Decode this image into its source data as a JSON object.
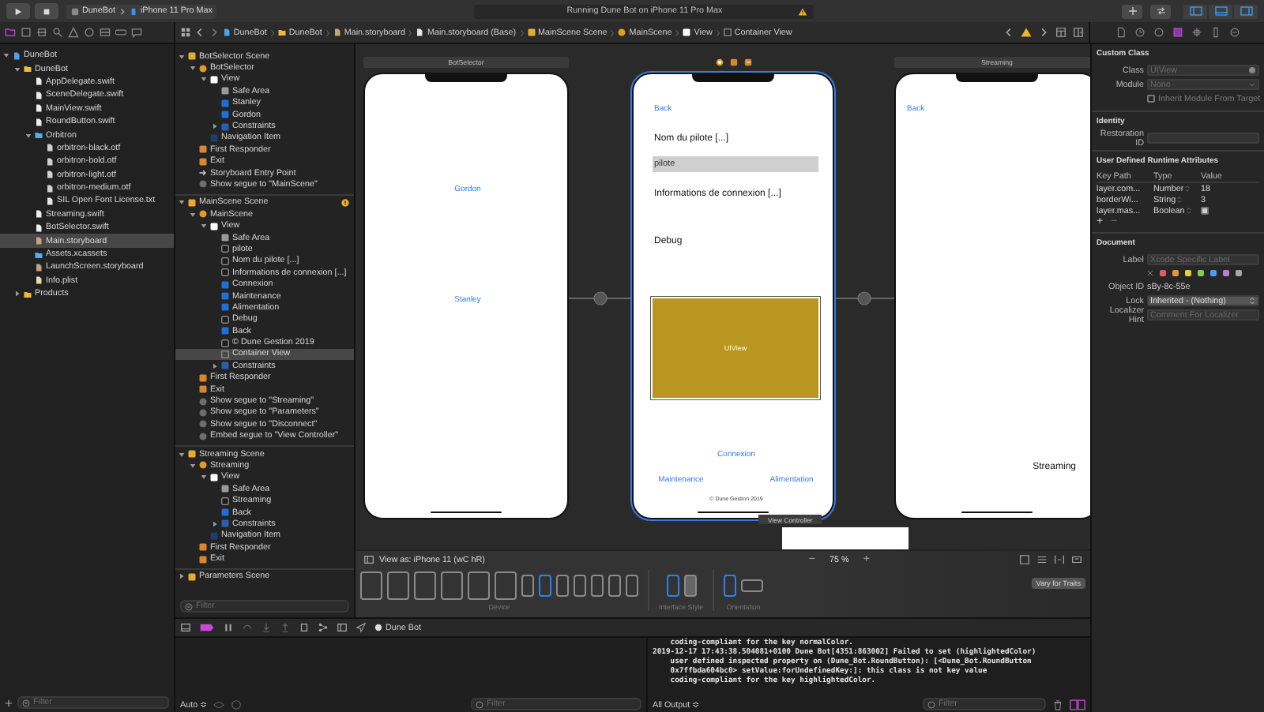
{
  "toolbar": {
    "scheme": "DuneBot",
    "device": "iPhone 11 Pro Max",
    "activity": "Running Dune Bot on iPhone 11 Pro Max",
    "panel_toggles": [
      {
        "kind": "navigator",
        "on": true
      },
      {
        "kind": "debug",
        "on": true
      },
      {
        "kind": "inspector",
        "on": true
      }
    ]
  },
  "navigator_tabs": [
    {
      "selected": true
    },
    {
      "selected": false
    },
    {
      "selected": false
    },
    {
      "selected": false
    },
    {
      "selected": false
    },
    {
      "selected": false
    },
    {
      "selected": false
    },
    {
      "selected": false
    },
    {
      "selected": false
    }
  ],
  "breadcrumbs": [
    {
      "label": "DuneBot",
      "kind": "project"
    },
    {
      "label": "DuneBot",
      "kind": "folder"
    },
    {
      "label": "Main.storyboard",
      "kind": "storyboard"
    },
    {
      "label": "Main.storyboard (Base)",
      "kind": "text"
    },
    {
      "label": "MainScene Scene",
      "kind": "scene"
    },
    {
      "label": "MainScene",
      "kind": "vc"
    },
    {
      "label": "View",
      "kind": "view"
    },
    {
      "label": "Container View",
      "kind": "container"
    }
  ],
  "inspector_tabs": [
    {
      "selected": false
    },
    {
      "selected": false
    },
    {
      "selected": false
    },
    {
      "selected": true
    },
    {
      "selected": false
    },
    {
      "selected": false
    },
    {
      "selected": false
    }
  ],
  "navigator": {
    "items": [
      {
        "label": "DuneBot",
        "kind": "project",
        "selected": false,
        "expanded": true,
        "children": [
          {
            "label": "DuneBot",
            "kind": "folder",
            "selected": false,
            "expanded": true,
            "children": [
              {
                "label": "AppDelegate.swift",
                "kind": "swift",
                "selected": false
              },
              {
                "label": "SceneDelegate.swift",
                "kind": "swift",
                "selected": false
              },
              {
                "label": "MainView.swift",
                "kind": "swift",
                "selected": false
              },
              {
                "label": "RoundButton.swift",
                "kind": "swift",
                "selected": false
              },
              {
                "label": "Orbitron",
                "kind": "bluefolder",
                "selected": false,
                "expanded": true,
                "children": [
                  {
                    "label": "orbitron-black.otf",
                    "kind": "font",
                    "selected": false
                  },
                  {
                    "label": "orbitron-bold.otf",
                    "kind": "font",
                    "selected": false
                  },
                  {
                    "label": "orbitron-light.otf",
                    "kind": "font",
                    "selected": false
                  },
                  {
                    "label": "orbitron-medium.otf",
                    "kind": "font",
                    "selected": false
                  },
                  {
                    "label": "SIL Open Font License.txt",
                    "kind": "text",
                    "selected": false
                  }
                ]
              },
              {
                "label": "Streaming.swift",
                "kind": "swift",
                "selected": false
              },
              {
                "label": "BotSelector.swift",
                "kind": "swift",
                "selected": false
              },
              {
                "label": "Main.storyboard",
                "kind": "storyboard",
                "selected": true
              },
              {
                "label": "Assets.xcassets",
                "kind": "assets",
                "selected": false
              },
              {
                "label": "LaunchScreen.storyboard",
                "kind": "storyboard",
                "selected": false
              },
              {
                "label": "Info.plist",
                "kind": "plist",
                "selected": false
              }
            ]
          },
          {
            "label": "Products",
            "kind": "folder",
            "selected": false,
            "expanded": false
          }
        ]
      }
    ],
    "filter_placeholder": "Filter"
  },
  "outline": {
    "items": [
      {
        "label": "BotSelector Scene",
        "kind": "scene",
        "selected": false,
        "warning": false,
        "expanded": true,
        "children": [
          {
            "label": "BotSelector",
            "kind": "vc",
            "selected": false,
            "expanded": true,
            "children": [
              {
                "label": "View",
                "kind": "view",
                "selected": false,
                "expanded": true,
                "children": [
                  {
                    "label": "Safe Area",
                    "kind": "safe",
                    "selected": false
                  },
                  {
                    "label": "Stanley",
                    "kind": "button",
                    "selected": false
                  },
                  {
                    "label": "Gordon",
                    "kind": "button",
                    "selected": false
                  },
                  {
                    "label": "Constraints",
                    "kind": "constraints",
                    "selected": false,
                    "expanded": false
                  }
                ]
              },
              {
                "label": "Navigation Item",
                "kind": "navitem",
                "selected": false
              }
            ]
          },
          {
            "label": "First Responder",
            "kind": "responder",
            "selected": false
          },
          {
            "label": "Exit",
            "kind": "exit",
            "selected": false
          },
          {
            "label": "Storyboard Entry Point",
            "kind": "entry",
            "selected": false
          },
          {
            "label": "Show segue to \"MainScene\"",
            "kind": "segue",
            "selected": false
          }
        ]
      },
      {
        "label": "MainScene Scene",
        "kind": "scene",
        "selected": false,
        "warning": true,
        "expanded": true,
        "children": [
          {
            "label": "MainScene",
            "kind": "vc",
            "selected": false,
            "expanded": true,
            "children": [
              {
                "label": "View",
                "kind": "view",
                "selected": false,
                "expanded": true,
                "children": [
                  {
                    "label": "Safe Area",
                    "kind": "safe",
                    "selected": false
                  },
                  {
                    "label": "pilote",
                    "kind": "field",
                    "selected": false
                  },
                  {
                    "label": "Nom du pilote [...]",
                    "kind": "label",
                    "selected": false
                  },
                  {
                    "label": "Informations de connexion [...]",
                    "kind": "label",
                    "selected": false
                  },
                  {
                    "label": "Connexion",
                    "kind": "button",
                    "selected": false
                  },
                  {
                    "label": "Maintenance",
                    "kind": "button",
                    "selected": false
                  },
                  {
                    "label": "Alimentation",
                    "kind": "button",
                    "selected": false
                  },
                  {
                    "label": "Debug",
                    "kind": "label",
                    "selected": false
                  },
                  {
                    "label": "Back",
                    "kind": "button",
                    "selected": false
                  },
                  {
                    "label": "© Dune Gestion 2019",
                    "kind": "label",
                    "selected": false
                  },
                  {
                    "label": "Container View",
                    "kind": "container",
                    "selected": true
                  },
                  {
                    "label": "Constraints",
                    "kind": "constraints",
                    "selected": false,
                    "expanded": false
                  }
                ]
              }
            ]
          },
          {
            "label": "First Responder",
            "kind": "responder",
            "selected": false
          },
          {
            "label": "Exit",
            "kind": "exit",
            "selected": false
          },
          {
            "label": "Show segue to \"Streaming\"",
            "kind": "segue",
            "selected": false
          },
          {
            "label": "Show segue to \"Parameters\"",
            "kind": "segue",
            "selected": false
          },
          {
            "label": "Show segue to \"Disconnect\"",
            "kind": "segue",
            "selected": false
          },
          {
            "label": "Embed segue to \"View Controller\"",
            "kind": "segue",
            "selected": false
          }
        ]
      },
      {
        "label": "Streaming Scene",
        "kind": "scene",
        "selected": false,
        "warning": false,
        "expanded": true,
        "children": [
          {
            "label": "Streaming",
            "kind": "vc",
            "selected": false,
            "expanded": true,
            "children": [
              {
                "label": "View",
                "kind": "view",
                "selected": false,
                "expanded": true,
                "children": [
                  {
                    "label": "Safe Area",
                    "kind": "safe",
                    "selected": false
                  },
                  {
                    "label": "Streaming",
                    "kind": "label",
                    "selected": false
                  },
                  {
                    "label": "Back",
                    "kind": "button",
                    "selected": false
                  },
                  {
                    "label": "Constraints",
                    "kind": "constraints",
                    "selected": false,
                    "expanded": false
                  }
                ]
              },
              {
                "label": "Navigation Item",
                "kind": "navitem",
                "selected": false
              }
            ]
          },
          {
            "label": "First Responder",
            "kind": "responder",
            "selected": false
          },
          {
            "label": "Exit",
            "kind": "exit",
            "selected": false
          }
        ]
      },
      {
        "label": "Parameters Scene",
        "kind": "scene",
        "selected": false,
        "warning": false,
        "expanded": false
      }
    ],
    "filter_placeholder": "Filter"
  },
  "canvas": {
    "scenes": [
      {
        "title": "BotSelector",
        "selected": false,
        "elements": [
          {
            "kind": "link",
            "text": "Gordon"
          },
          {
            "kind": "link",
            "text": "Stanley"
          }
        ]
      },
      {
        "selected": true,
        "elements": [
          {
            "kind": "link",
            "text": "Back"
          },
          {
            "kind": "title",
            "text": "Nom du pilote [...]"
          },
          {
            "kind": "field",
            "text": "pilote"
          },
          {
            "kind": "title",
            "text": "Informations de connexion [...]"
          },
          {
            "kind": "title",
            "text": "Debug"
          },
          {
            "kind": "container",
            "text": "UIView"
          },
          {
            "kind": "link",
            "text": "Connexion"
          },
          {
            "kind": "link",
            "text": "Maintenance"
          },
          {
            "kind": "link",
            "text": "Alimentation"
          },
          {
            "kind": "small",
            "text": "© Dune Gestion 2019"
          }
        ]
      },
      {
        "title": "Streaming",
        "selected": false,
        "elements": [
          {
            "kind": "link",
            "text": "Back"
          },
          {
            "kind": "title",
            "text": "Streaming"
          }
        ]
      }
    ],
    "embedded_title": "View Controller"
  },
  "device_bar": {
    "view_as": "View as: iPhone 11 (wC hR)",
    "zoom_out": "−",
    "zoom": "75 %",
    "zoom_in": "+",
    "devices": [
      {
        "kind": "ipad",
        "selected": false
      },
      {
        "kind": "ipad",
        "selected": false
      },
      {
        "kind": "ipad",
        "selected": false
      },
      {
        "kind": "ipad",
        "selected": false
      },
      {
        "kind": "ipad",
        "selected": false
      },
      {
        "kind": "ipad",
        "selected": false
      },
      {
        "kind": "iphone",
        "selected": false
      },
      {
        "kind": "iphone",
        "selected": true
      },
      {
        "kind": "iphone",
        "selected": false
      },
      {
        "kind": "iphone",
        "selected": false
      },
      {
        "kind": "iphone",
        "selected": false
      },
      {
        "kind": "iphone",
        "selected": false
      },
      {
        "kind": "iphone",
        "selected": false
      }
    ],
    "device_label": "Device",
    "styles": [
      {
        "kind": "light",
        "selected": true
      },
      {
        "kind": "dark",
        "selected": false
      }
    ],
    "style_label": "Interface Style",
    "orientations": [
      {
        "kind": "portrait",
        "selected": true
      },
      {
        "kind": "landscape",
        "selected": false
      }
    ],
    "orientation_label": "Orientation",
    "vary_button": "Vary for Traits"
  },
  "debug": {
    "process": "Dune Bot",
    "variables_mode": "Auto ≎",
    "filter_placeholder": "Filter",
    "output_mode": "All Output ≎",
    "console_filter_placeholder": "Filter",
    "console_lines": [
      "    coding-compliant for the key normalColor.",
      "2019-12-17 17:43:38.504081+0100 Dune Bot[4351:863002] Failed to set (highlightedColor)",
      "    user defined inspected property on (Dune_Bot.RoundButton): [<Dune_Bot.RoundButton",
      "    0x7ffbda604bc0> setValue:forUndefinedKey:]: this class is not key value",
      "    coding-compliant for the key highlightedColor."
    ]
  },
  "inspector": {
    "custom_class": {
      "heading": "Custom Class",
      "class_label": "Class",
      "class_placeholder": "UIView",
      "module_label": "Module",
      "module_placeholder": "None",
      "inherit_label": "Inherit Module From Target",
      "inherit_checked": false
    },
    "identity": {
      "heading": "Identity",
      "restoration_label": "Restoration ID"
    },
    "runtime_attributes": {
      "heading": "User Defined Runtime Attributes",
      "columns": [
        "Key Path",
        "Type",
        "Value"
      ],
      "rows": [
        {
          "kind": "text",
          "key_path": "layer.com...",
          "type": "Number",
          "value": "18"
        },
        {
          "kind": "text",
          "key_path": "borderWi...",
          "type": "String",
          "value": "3"
        },
        {
          "kind": "checkbox",
          "key_path": "layer.mas...",
          "type": "Boolean",
          "checked": true
        }
      ],
      "add": "+",
      "remove": "−"
    },
    "document": {
      "heading": "Document",
      "label_label": "Label",
      "label_placeholder": "Xcode Specific Label",
      "colors": [
        {
          "color": "#e45b5b"
        },
        {
          "color": "#e8953a"
        },
        {
          "color": "#e8cf3c"
        },
        {
          "color": "#86c85a"
        },
        {
          "color": "#4a9ff0"
        },
        {
          "color": "#b67fd8"
        },
        {
          "color": "#a8a8a8"
        }
      ],
      "object_id_label": "Object ID",
      "object_id": "sBy-8c-55e",
      "lock_label": "Lock",
      "lock_value": "Inherited - (Nothing)",
      "hint_label": "Localizer Hint",
      "hint_placeholder": "Comment For Localizer"
    }
  }
}
